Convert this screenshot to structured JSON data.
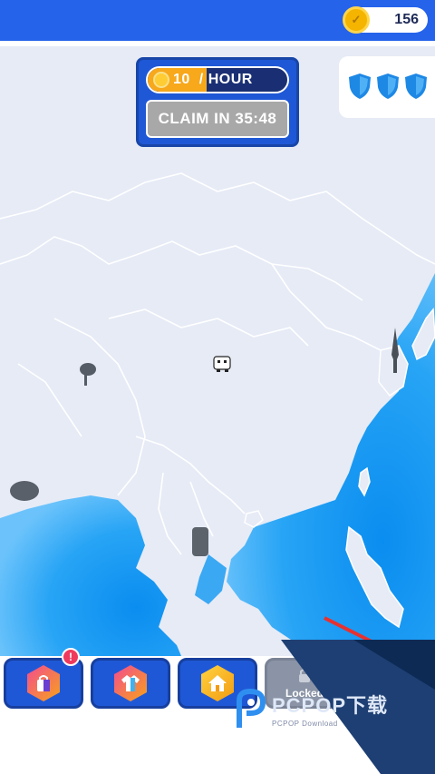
{
  "header": {
    "coins": "156"
  },
  "income": {
    "rate_value": "10",
    "rate_unit": "/ HOUR",
    "rate_progress": 0.42,
    "claim_label": "CLAIM IN 35:48"
  },
  "shields": {
    "count": 3,
    "icon": "shield-icon",
    "color": "#1e88e5"
  },
  "bottom": {
    "tiles": [
      {
        "icon": "shop-bag-icon"
      },
      {
        "icon": "shirt-icon"
      },
      {
        "icon": "house-icon"
      },
      {
        "label": "Locked",
        "icon": "lock-icon"
      }
    ],
    "badge": "!"
  },
  "watermark": {
    "brand": "PCPOP下载",
    "sub": "PCPOP Download"
  },
  "colors": {
    "accent": "#2563eb",
    "ocean": "#2196f3",
    "land": "#e6ebf6",
    "coin": "#f4b400"
  }
}
